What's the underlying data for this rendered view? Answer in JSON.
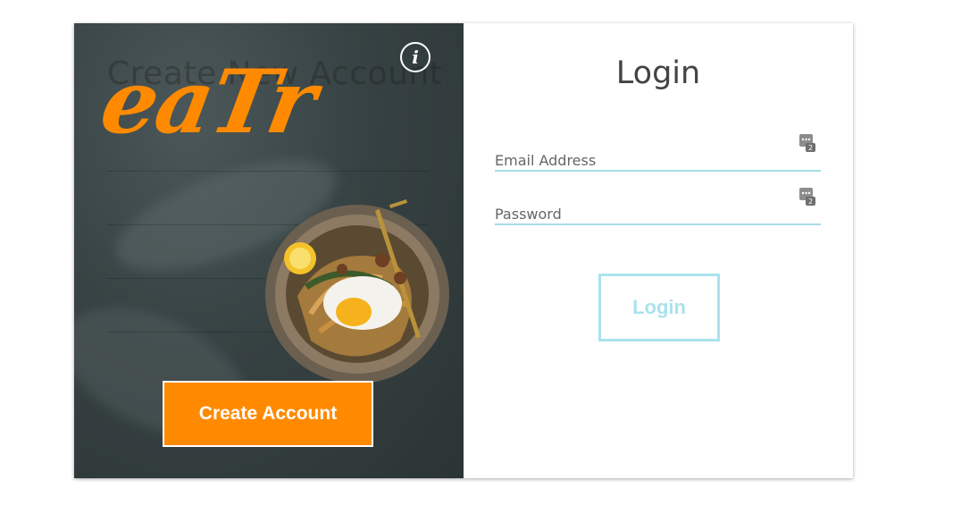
{
  "left_panel": {
    "ghost_title": "Create New Account",
    "logo_text": "eaTr",
    "info_icon": "info-icon",
    "create_button_label": "Create Account",
    "brand_color": "#ff8a00"
  },
  "right_panel": {
    "title": "Login",
    "email_label": "Email Address",
    "password_label": "Password",
    "field_icon": "password-manager-icon",
    "login_button_label": "Login",
    "accent_color": "#a9e3ec"
  }
}
